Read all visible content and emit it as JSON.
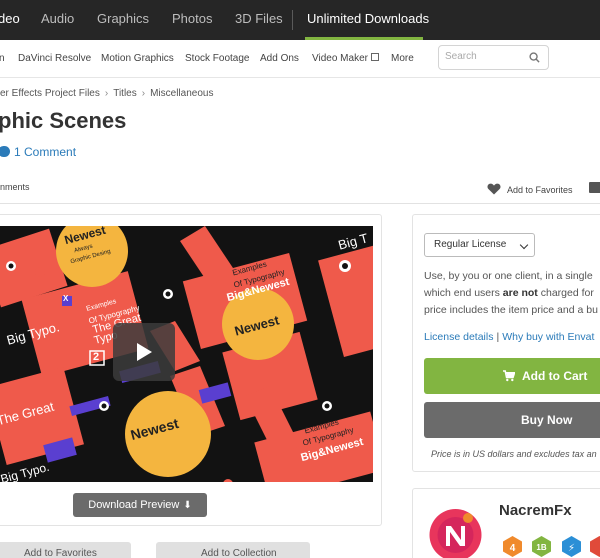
{
  "topnav": {
    "items": [
      "deo",
      "Audio",
      "Graphics",
      "Photos",
      "3D Files",
      "Unlimited Downloads"
    ]
  },
  "subnav": {
    "items": [
      "n",
      "DaVinci Resolve",
      "Motion Graphics",
      "Stock Footage",
      "Add Ons",
      "Video Maker",
      "More"
    ],
    "search_placeholder": "Search"
  },
  "breadcrumb": [
    "er Effects Project Files",
    "Titles",
    "Miscellaneous"
  ],
  "page": {
    "title": "phic Scenes",
    "comment_count_label": "1 Comment",
    "tab_comments": "nments",
    "add_to_favorites": "Add to Favorites"
  },
  "preview": {
    "download_label": "Download Preview",
    "add_to_favorites": "Add to Favorites",
    "add_to_collection": "Add to Collection",
    "overlay_text": {
      "newest": "Newest",
      "always": "Always",
      "graphic_desing": "Graphic Desing",
      "examples": "Examples",
      "of_typography": "Of Typography",
      "big_newest": "Big&Newest",
      "the_great": "The Great",
      "typo": "Typo",
      "big_typo": "Big Typo.",
      "big_t": "Big T",
      "two": "2",
      "x": "X"
    }
  },
  "purchase": {
    "license": "Regular License",
    "desc_line1": "Use, by you or one client, in a single",
    "desc_line2_pre": "which end users ",
    "desc_line2_bold": "are not",
    "desc_line2_post": " charged for",
    "desc_line3": "price includes the item price and a bu",
    "license_details": "License details",
    "why_buy": "Why buy with Envat",
    "add_to_cart": "Add to Cart",
    "buy_now": "Buy Now",
    "price_note": "Price is in US dollars and excludes tax an"
  },
  "author": {
    "name": "NacremFx",
    "badges": [
      {
        "label": "4",
        "color": "#f08a2c"
      },
      {
        "label": "1B",
        "color": "#82b541"
      },
      {
        "label": "⚡",
        "color": "#2b8fd6"
      },
      {
        "label": "",
        "color": "#e04a3a"
      }
    ]
  },
  "colors": {
    "accent_green": "#82b541",
    "link_blue": "#2b7bb9",
    "dark_nav": "#262626",
    "poster_red": "#ef5a4b",
    "poster_yellow": "#f4b53f",
    "poster_purple": "#5a3fd0"
  }
}
